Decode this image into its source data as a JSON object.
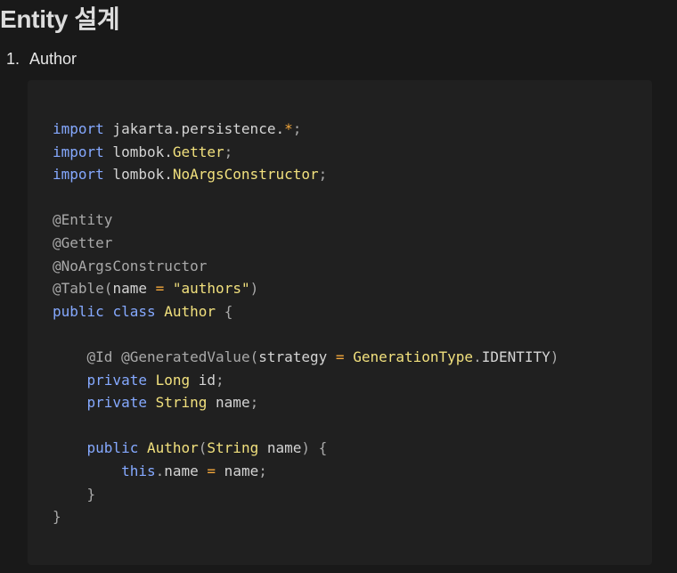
{
  "page": {
    "heading": "Entity 설계",
    "list_item": {
      "number": "1.",
      "label": "Author"
    }
  },
  "code": {
    "language": "java",
    "lines": [
      [
        {
          "t": "kw",
          "v": "import"
        },
        {
          "t": "pln",
          "v": " jakarta.persistence."
        },
        {
          "t": "op",
          "v": "*"
        },
        {
          "t": "pun",
          "v": ";"
        }
      ],
      [
        {
          "t": "kw",
          "v": "import"
        },
        {
          "t": "pln",
          "v": " lombok."
        },
        {
          "t": "cls",
          "v": "Getter"
        },
        {
          "t": "pun",
          "v": ";"
        }
      ],
      [
        {
          "t": "kw",
          "v": "import"
        },
        {
          "t": "pln",
          "v": " lombok."
        },
        {
          "t": "cls",
          "v": "NoArgsConstructor"
        },
        {
          "t": "pun",
          "v": ";"
        }
      ],
      [],
      [
        {
          "t": "ann",
          "v": "@Entity"
        }
      ],
      [
        {
          "t": "ann",
          "v": "@Getter"
        }
      ],
      [
        {
          "t": "ann",
          "v": "@NoArgsConstructor"
        }
      ],
      [
        {
          "t": "ann",
          "v": "@Table"
        },
        {
          "t": "pun",
          "v": "("
        },
        {
          "t": "pln",
          "v": "name "
        },
        {
          "t": "op",
          "v": "="
        },
        {
          "t": "pln",
          "v": " "
        },
        {
          "t": "str",
          "v": "\"authors\""
        },
        {
          "t": "pun",
          "v": ")"
        }
      ],
      [
        {
          "t": "kw",
          "v": "public"
        },
        {
          "t": "pln",
          "v": " "
        },
        {
          "t": "kw",
          "v": "class"
        },
        {
          "t": "pln",
          "v": " "
        },
        {
          "t": "cls",
          "v": "Author"
        },
        {
          "t": "pln",
          "v": " "
        },
        {
          "t": "pun",
          "v": "{"
        }
      ],
      [],
      [
        {
          "t": "pln",
          "v": "    "
        },
        {
          "t": "ann",
          "v": "@Id"
        },
        {
          "t": "pln",
          "v": " "
        },
        {
          "t": "ann",
          "v": "@GeneratedValue"
        },
        {
          "t": "pun",
          "v": "("
        },
        {
          "t": "pln",
          "v": "strategy "
        },
        {
          "t": "op",
          "v": "="
        },
        {
          "t": "pln",
          "v": " "
        },
        {
          "t": "cls",
          "v": "GenerationType"
        },
        {
          "t": "pun",
          "v": "."
        },
        {
          "t": "pln",
          "v": "IDENTITY"
        },
        {
          "t": "pun",
          "v": ")"
        }
      ],
      [
        {
          "t": "pln",
          "v": "    "
        },
        {
          "t": "kw",
          "v": "private"
        },
        {
          "t": "pln",
          "v": " "
        },
        {
          "t": "cls",
          "v": "Long"
        },
        {
          "t": "pln",
          "v": " id"
        },
        {
          "t": "pun",
          "v": ";"
        }
      ],
      [
        {
          "t": "pln",
          "v": "    "
        },
        {
          "t": "kw",
          "v": "private"
        },
        {
          "t": "pln",
          "v": " "
        },
        {
          "t": "cls",
          "v": "String"
        },
        {
          "t": "pln",
          "v": " name"
        },
        {
          "t": "pun",
          "v": ";"
        }
      ],
      [],
      [
        {
          "t": "pln",
          "v": "    "
        },
        {
          "t": "kw",
          "v": "public"
        },
        {
          "t": "pln",
          "v": " "
        },
        {
          "t": "cls",
          "v": "Author"
        },
        {
          "t": "pun",
          "v": "("
        },
        {
          "t": "cls",
          "v": "String"
        },
        {
          "t": "pln",
          "v": " name"
        },
        {
          "t": "pun",
          "v": ")"
        },
        {
          "t": "pln",
          "v": " "
        },
        {
          "t": "pun",
          "v": "{"
        }
      ],
      [
        {
          "t": "pln",
          "v": "        "
        },
        {
          "t": "kw",
          "v": "this"
        },
        {
          "t": "pun",
          "v": "."
        },
        {
          "t": "pln",
          "v": "name "
        },
        {
          "t": "op",
          "v": "="
        },
        {
          "t": "pln",
          "v": " name"
        },
        {
          "t": "pun",
          "v": ";"
        }
      ],
      [
        {
          "t": "pln",
          "v": "    "
        },
        {
          "t": "pun",
          "v": "}"
        }
      ],
      [
        {
          "t": "pun",
          "v": "}"
        }
      ]
    ]
  },
  "colors": {
    "background": "#191919",
    "code_background": "#202020",
    "keyword": "#85a9ff",
    "class_name": "#f1e07d",
    "annotation": "#a9a9a9",
    "operator": "#f3a73b",
    "string": "#f1e07d",
    "plain": "#d4d4d4"
  }
}
